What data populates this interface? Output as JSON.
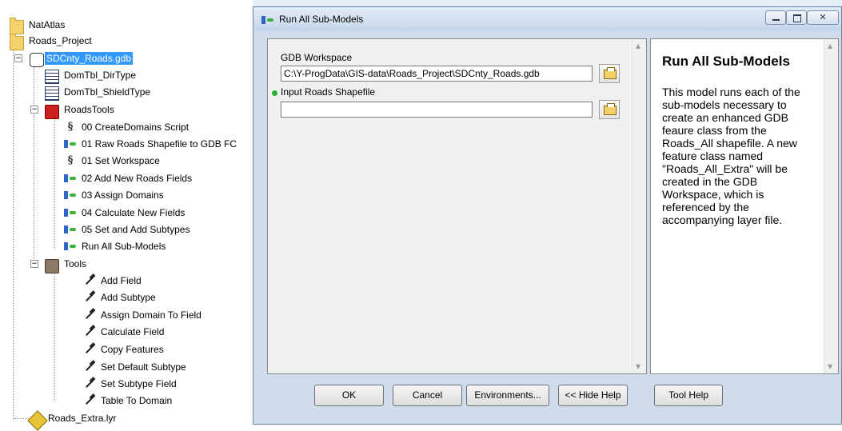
{
  "tree": {
    "nodes": [
      {
        "label": "NatAtlas"
      },
      {
        "label": "Roads_Project"
      },
      {
        "label": "SDCnty_Roads.gdb"
      },
      {
        "label": "DomTbl_DirType"
      },
      {
        "label": "DomTbl_ShieldType"
      },
      {
        "label": "RoadsTools"
      },
      {
        "label": "00 CreateDomains Script"
      },
      {
        "label": "01 Raw Roads Shapefile to GDB FC"
      },
      {
        "label": "01 Set Workspace"
      },
      {
        "label": "02 Add New Roads Fields"
      },
      {
        "label": "03 Assign Domains"
      },
      {
        "label": "04 Calculate New Fields"
      },
      {
        "label": "05 Set and Add Subtypes"
      },
      {
        "label": "Run All Sub-Models"
      },
      {
        "label": "Tools"
      },
      {
        "label": "Add Field"
      },
      {
        "label": "Add Subtype"
      },
      {
        "label": "Assign Domain To Field"
      },
      {
        "label": "Calculate Field"
      },
      {
        "label": "Copy Features"
      },
      {
        "label": "Set Default Subtype"
      },
      {
        "label": "Set Subtype Field"
      },
      {
        "label": "Table To Domain"
      },
      {
        "label": "Roads_Extra.lyr"
      }
    ]
  },
  "dialog": {
    "title": "Run All Sub-Models",
    "params": {
      "gdb_workspace_label": "GDB Workspace",
      "gdb_workspace_value": "C:\\Y-ProgData\\GIS-data\\Roads_Project\\SDCnty_Roads.gdb",
      "input_shapefile_label": "Input Roads Shapefile",
      "input_shapefile_value": ""
    },
    "help": {
      "title": "Run All Sub-Models",
      "body": "This model runs each of the sub-models necessary to create an enhanced GDB feaure class from the Roads_All shapefile. A new feature class named \"Roads_All_Extra\" will be created in the GDB Workspace, which is referenced by the accompanying layer file."
    },
    "buttons": {
      "ok": "OK",
      "cancel": "Cancel",
      "environments": "Environments...",
      "hide_help": "<< Hide Help",
      "tool_help": "Tool Help"
    }
  },
  "colors": {
    "selection": "#3399ff",
    "required_dot": "#29b229",
    "dialog_bg": "#cfdcec"
  }
}
